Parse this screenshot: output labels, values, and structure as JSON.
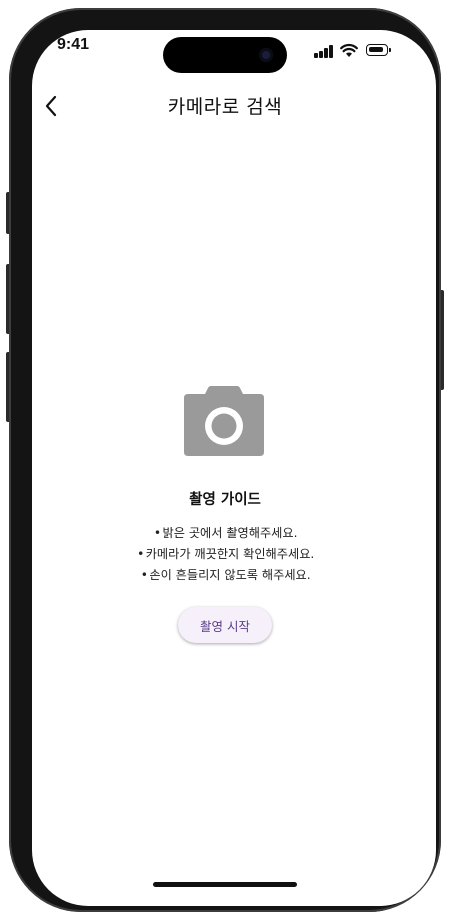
{
  "status_bar": {
    "time": "9:41",
    "icons": [
      "signal-icon",
      "wifi-icon",
      "battery-icon"
    ],
    "battery_level": 0.9
  },
  "header": {
    "back_icon": "chevron-left-icon",
    "title": "카메라로 검색"
  },
  "guide": {
    "icon": "camera-icon",
    "title": "촬영 가이드",
    "items": [
      "밝은 곳에서 촬영해주세요.",
      "카메라가 깨끗한지 확인해주세요.",
      "손이 흔들리지 않도록 해주세요."
    ],
    "bullet": "•"
  },
  "actions": {
    "start_label": "촬영 시작"
  },
  "colors": {
    "camera_icon": "#9a9a9a",
    "button_bg": "#f6f0fb",
    "button_text": "#5b3d88",
    "frame": "#141414"
  }
}
